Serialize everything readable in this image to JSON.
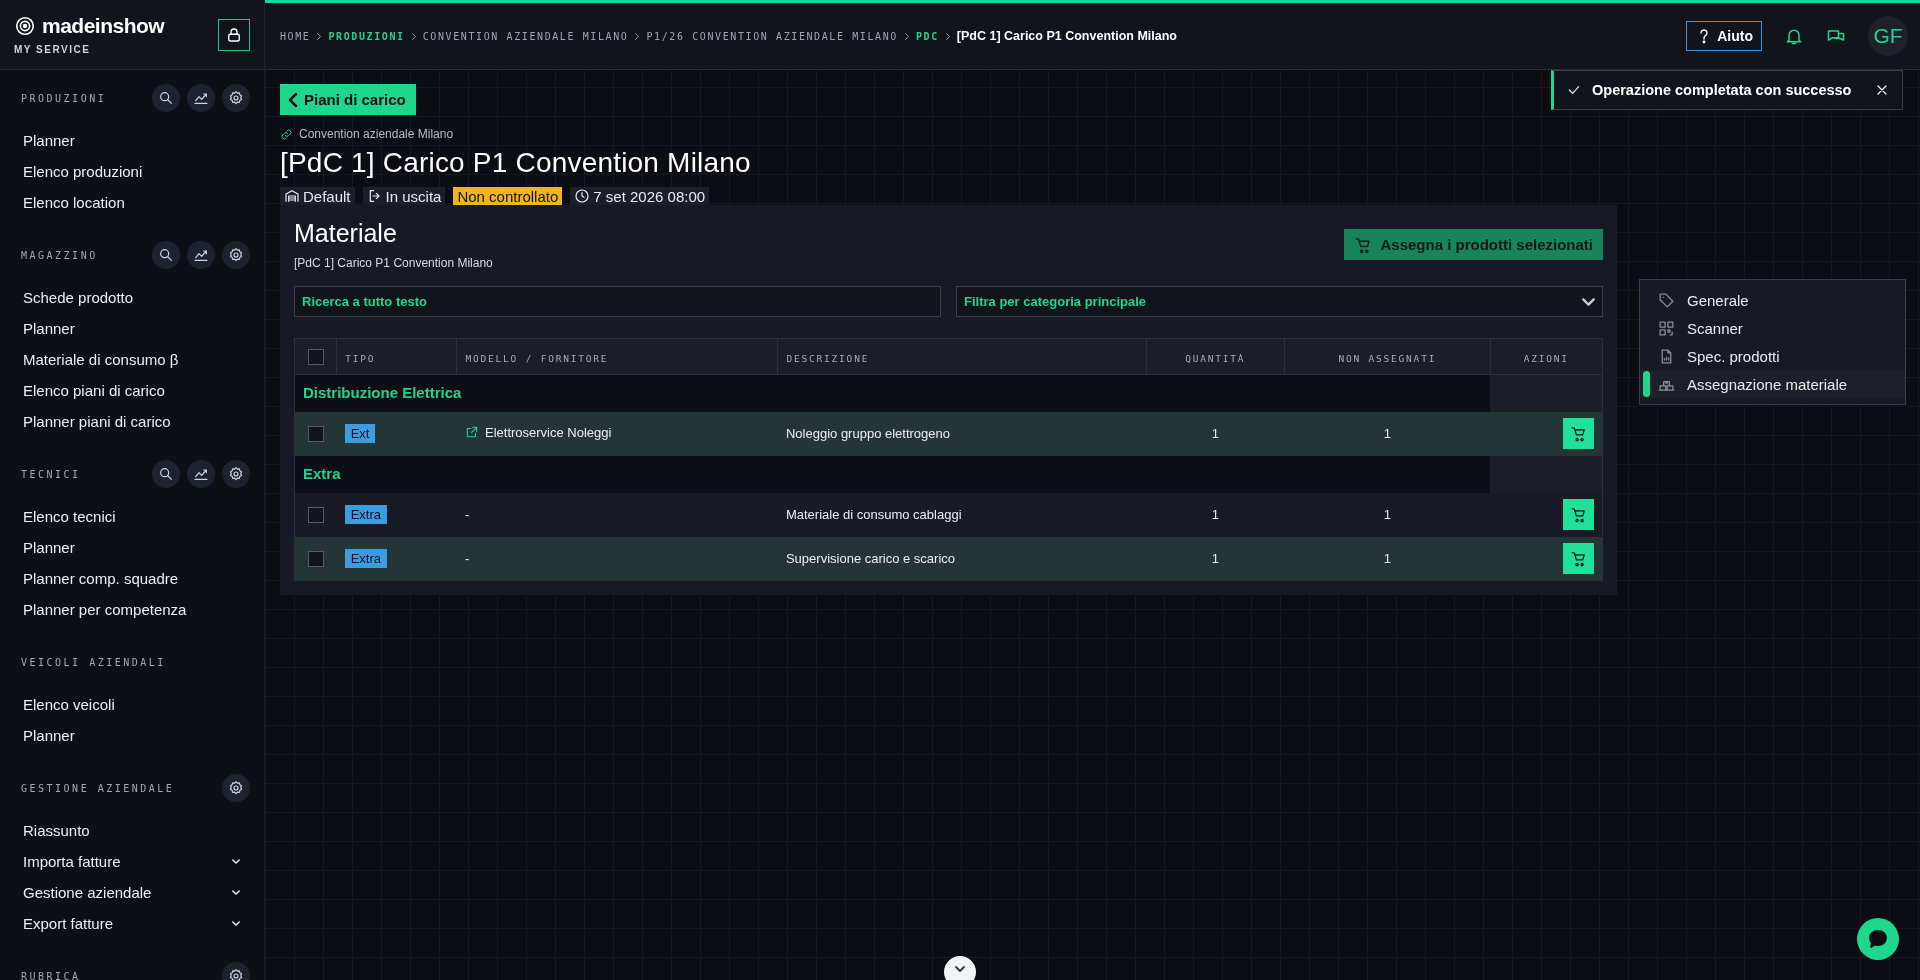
{
  "brand": {
    "name": "madeinshow",
    "subtitle": "MY SERVICE"
  },
  "sidebar": {
    "sections": [
      {
        "title": "PRODUZIONI",
        "kind": "tools",
        "items": [
          {
            "label": "Planner",
            "expandable": false
          },
          {
            "label": "Elenco produzioni",
            "expandable": false
          },
          {
            "label": "Elenco location",
            "expandable": false
          }
        ]
      },
      {
        "title": "MAGAZZINO",
        "kind": "tools",
        "items": [
          {
            "label": "Schede prodotto",
            "expandable": false
          },
          {
            "label": "Planner",
            "expandable": false
          },
          {
            "label": "Materiale di consumo β",
            "expandable": false
          },
          {
            "label": "Elenco piani di carico",
            "expandable": false
          },
          {
            "label": "Planner piani di carico",
            "expandable": false
          }
        ]
      },
      {
        "title": "TECNICI",
        "kind": "tools",
        "items": [
          {
            "label": "Elenco tecnici",
            "expandable": false
          },
          {
            "label": "Planner",
            "expandable": false
          },
          {
            "label": "Planner comp. squadre",
            "expandable": false
          },
          {
            "label": "Planner per competenza",
            "expandable": false
          }
        ]
      },
      {
        "title": "VEICOLI AZIENDALI",
        "kind": "none",
        "items": [
          {
            "label": "Elenco veicoli",
            "expandable": false
          },
          {
            "label": "Planner",
            "expandable": false
          }
        ]
      },
      {
        "title": "GESTIONE AZIENDALE",
        "kind": "settings",
        "items": [
          {
            "label": "Riassunto",
            "expandable": false
          },
          {
            "label": "Importa fatture",
            "expandable": true
          },
          {
            "label": "Gestione aziendale",
            "expandable": true
          },
          {
            "label": "Export fatture",
            "expandable": true
          }
        ]
      },
      {
        "title": "RUBRICA",
        "kind": "settings"
      }
    ]
  },
  "breadcrumb": [
    {
      "label": "HOME",
      "kind": "plain"
    },
    {
      "label": "PRODUZIONI",
      "kind": "accent"
    },
    {
      "label": "CONVENTION AZIENDALE MILANO",
      "kind": "plain"
    },
    {
      "label": "P1/26 CONVENTION AZIENDALE MILANO",
      "kind": "plain"
    },
    {
      "label": "PDC",
      "kind": "accent"
    },
    {
      "label": "[PdC 1] Carico P1 Convention Milano",
      "kind": "current"
    }
  ],
  "header": {
    "help": "Aiuto",
    "avatar": "GF"
  },
  "toast": {
    "message": "Operazione completata con successo"
  },
  "back_button": "Piani di carico",
  "parent_link": "Convention aziendale Milano",
  "title": "[PdC 1] Carico P1 Convention Milano",
  "tags": [
    {
      "label": "Default",
      "kind": "location"
    },
    {
      "label": "In uscita",
      "kind": "direction"
    },
    {
      "label": "Non controllato",
      "kind": "status"
    },
    {
      "label": "7 set 2026 08:00",
      "kind": "date"
    }
  ],
  "panel": {
    "title": "Materiale",
    "subtitle": "[PdC 1] Carico P1 Convention Milano",
    "assign_button": "Assegna i prodotti selezionati",
    "search": {
      "placeholder": "Ricerca a tutto testo"
    },
    "filter": {
      "placeholder": "Filtra per categoria principale"
    },
    "table": {
      "columns": [
        "TIPO",
        "MODELLO / FORNITORE",
        "DESCRIZIONE",
        "QUANTITÀ",
        "NON ASSEGNATI",
        "AZIONI"
      ],
      "all_checked": false,
      "groups": [
        {
          "name": "Distribuzione Elettrica",
          "rows": [
            {
              "checked": false,
              "highlighted": true,
              "type": "Ext",
              "model": "Elettroservice Noleggi",
              "external_link": true,
              "description": "Noleggio gruppo elettrogeno",
              "quantity": "1",
              "unassigned": "1"
            }
          ]
        },
        {
          "name": "Extra",
          "rows": [
            {
              "checked": false,
              "highlighted": false,
              "type": "Extra",
              "model": "-",
              "external_link": false,
              "description": "Materiale di consumo cablaggi",
              "quantity": "1",
              "unassigned": "1"
            },
            {
              "checked": false,
              "highlighted": true,
              "type": "Extra",
              "model": "-",
              "external_link": false,
              "description": "Supervisione carico e scarico",
              "quantity": "1",
              "unassigned": "1"
            }
          ]
        }
      ]
    }
  },
  "side_menu": [
    {
      "label": "Generale",
      "kind": "tag",
      "selected": false
    },
    {
      "label": "Scanner",
      "kind": "scanner",
      "selected": false
    },
    {
      "label": "Spec. prodotti",
      "kind": "document",
      "selected": false
    },
    {
      "label": "Assegnazione materiale",
      "kind": "boxes",
      "selected": true
    }
  ]
}
